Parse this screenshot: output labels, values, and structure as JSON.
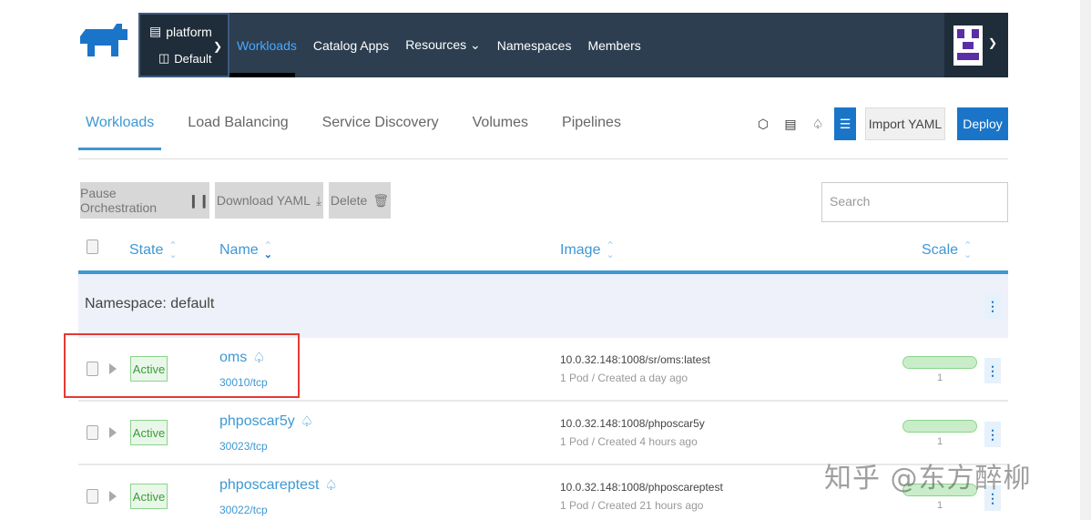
{
  "header": {
    "cluster_name": "platform",
    "project_name": "Default",
    "nav": [
      {
        "label": "Workloads",
        "active": true
      },
      {
        "label": "Catalog Apps",
        "active": false
      },
      {
        "label": "Resources",
        "active": false,
        "has_dropdown": true
      },
      {
        "label": "Namespaces",
        "active": false
      },
      {
        "label": "Members",
        "active": false
      }
    ],
    "colors": {
      "bar": "#2c3e50",
      "active_link": "#4aa8ff"
    }
  },
  "subnav": {
    "tabs": [
      {
        "label": "Workloads",
        "active": true
      },
      {
        "label": "Load Balancing",
        "active": false
      },
      {
        "label": "Service Discovery",
        "active": false
      },
      {
        "label": "Volumes",
        "active": false
      },
      {
        "label": "Pipelines",
        "active": false
      }
    ],
    "view_icons": [
      "node-view-icon",
      "list-view-icon",
      "group-view-icon",
      "tree-view-icon"
    ],
    "import_label": "Import YAML",
    "deploy_label": "Deploy"
  },
  "actions": {
    "pause_label": "Pause Orchestration",
    "download_label": "Download YAML",
    "delete_label": "Delete",
    "search_placeholder": "Search"
  },
  "table": {
    "headers": {
      "state": "State",
      "name": "Name",
      "image": "Image",
      "scale": "Scale"
    },
    "namespace_label": "Namespace: default",
    "rows": [
      {
        "state": "Active",
        "name": "oms",
        "port": "30010/tcp",
        "image": "10.0.32.148:1008/sr/oms:latest",
        "meta": "1 Pod / Created a day ago",
        "scale": "1",
        "scale_fraction": 1
      },
      {
        "state": "Active",
        "name": "phposcar5y",
        "port": "30023/tcp",
        "image": "10.0.32.148:1008/phposcar5y",
        "meta": "1 Pod / Created 4 hours ago",
        "scale": "1",
        "scale_fraction": 1
      },
      {
        "state": "Active",
        "name": "phposcareptest",
        "port": "30022/tcp",
        "image": "10.0.32.148:1008/phposcareptest",
        "meta": "1 Pod / Created 21 hours ago",
        "scale": "1",
        "scale_fraction": 1
      }
    ]
  },
  "watermark": "知乎 @东方醉柳",
  "colors": {
    "primary": "#1a75c9",
    "link": "#3d98d3",
    "active_green": "#3c9a3c",
    "highlight_red": "#e53935"
  }
}
